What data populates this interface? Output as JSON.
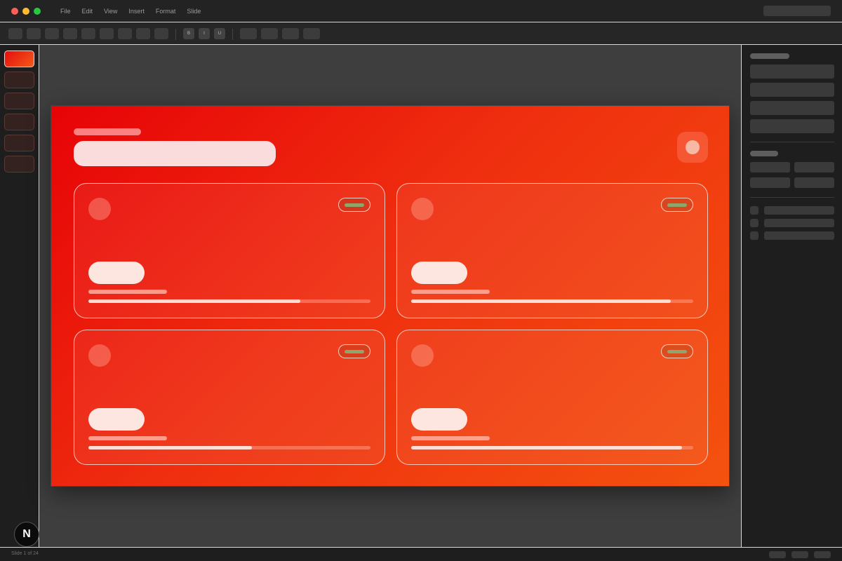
{
  "menu": {
    "items": [
      "File",
      "Edit",
      "View",
      "Insert",
      "Format",
      "Slide"
    ]
  },
  "toolbar": {
    "bold_label": "B",
    "italic_label": "I",
    "underline_label": "U"
  },
  "thumbnails": {
    "count": 6,
    "active_index": 0
  },
  "slide": {
    "background_gradient": [
      "#e70307",
      "#f4520f"
    ],
    "cards": [
      {
        "progress": 0.75,
        "tag_color": "#8fa56a"
      },
      {
        "progress": 0.92,
        "tag_color": "#8fa56a"
      },
      {
        "progress": 0.58,
        "tag_color": "#8fa56a"
      },
      {
        "progress": 0.96,
        "tag_color": "#8fa56a"
      }
    ]
  },
  "statusbar": {
    "slide_info": "Slide 1 of 24"
  },
  "logo": {
    "letter": "N"
  },
  "colors": {
    "accent": "#e70307",
    "panel": "#1e1e1e",
    "canvas": "#3e3e3e"
  }
}
